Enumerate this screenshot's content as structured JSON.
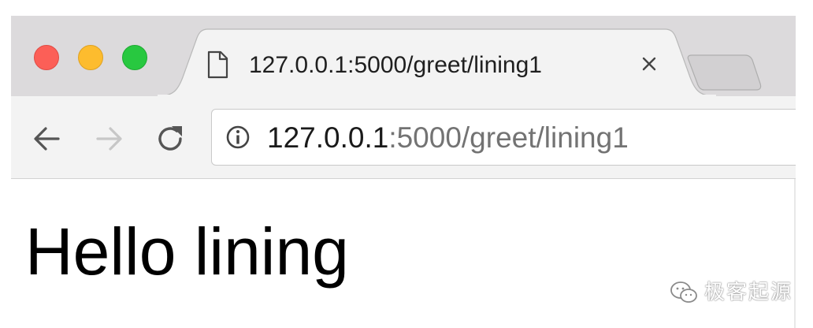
{
  "window": {
    "controls": {
      "close_color": "#fc5f57",
      "minimize_color": "#fdbc2e",
      "zoom_color": "#28c840"
    }
  },
  "tab": {
    "title": "127.0.0.1:5000/greet/lining1",
    "icon": "file-icon",
    "close_icon": "close-icon"
  },
  "toolbar": {
    "back_icon": "arrow-left-icon",
    "forward_icon": "arrow-right-icon",
    "reload_icon": "reload-icon"
  },
  "address_bar": {
    "security_icon": "info-icon",
    "url_host": "127.0.0.1",
    "url_rest": ":5000/greet/lining1",
    "host_color": "#1a1a1a",
    "path_color": "#737373"
  },
  "page": {
    "heading": "Hello lining"
  },
  "watermark": {
    "icon": "wechat-icon",
    "text": "极客起源"
  }
}
